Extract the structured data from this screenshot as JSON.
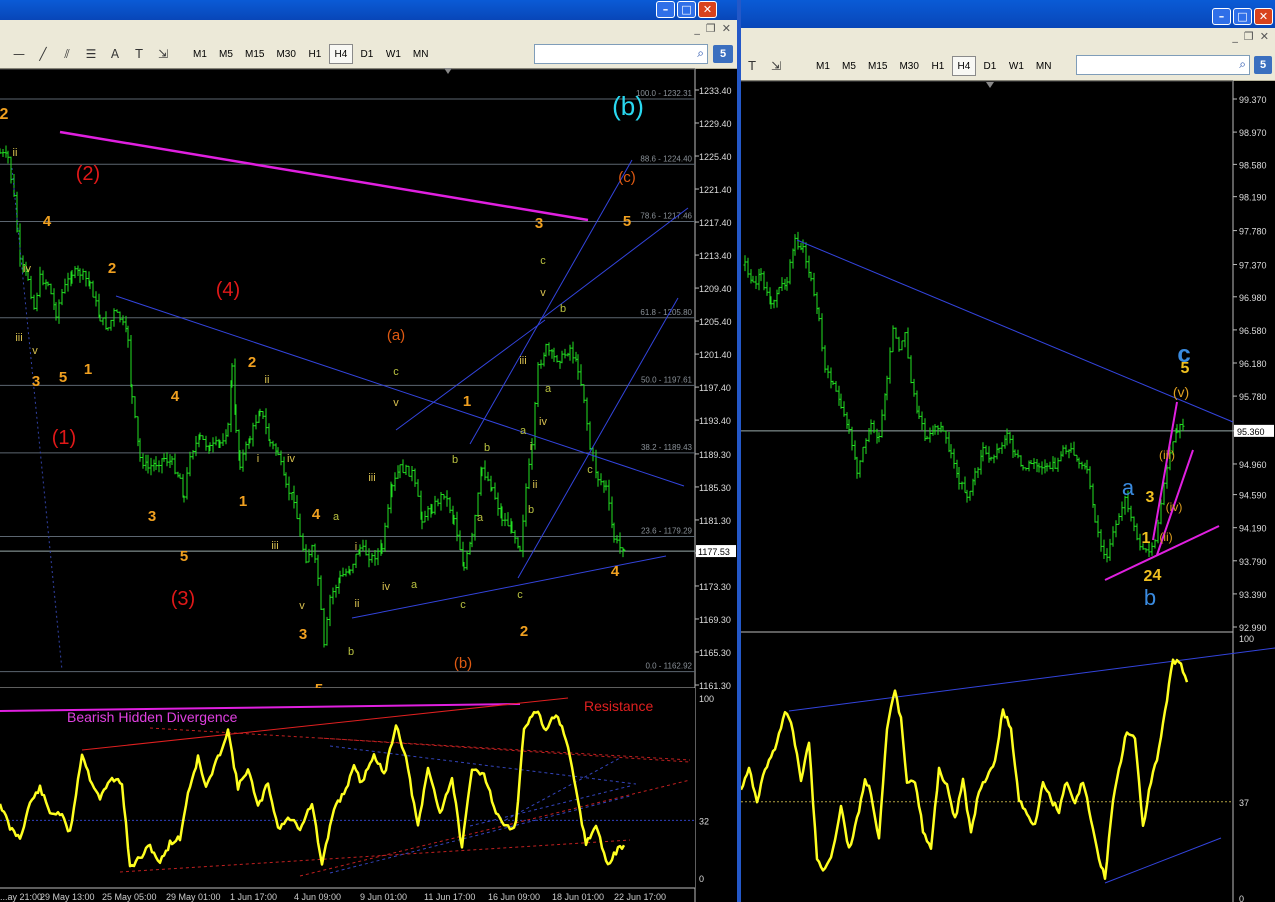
{
  "toolbar_left": {
    "timeframes": [
      "M1",
      "M5",
      "M15",
      "M30",
      "H1",
      "H4",
      "D1",
      "W1",
      "MN"
    ],
    "active_timeframe": "H4",
    "badge": "5",
    "tools": [
      "line",
      "diagonal",
      "channel",
      "fibo",
      "text",
      "label",
      "shapes"
    ]
  },
  "toolbar_right": {
    "timeframes": [
      "M1",
      "M5",
      "M15",
      "M30",
      "H1",
      "H4",
      "D1",
      "W1",
      "MN"
    ],
    "active_timeframe": "H4",
    "badge": "5"
  },
  "chart_data": [
    {
      "type": "line",
      "panel": "left-price",
      "y_ticks": [
        "1233.40",
        "1229.40",
        "1225.40",
        "1221.40",
        "1217.40",
        "1213.40",
        "1209.40",
        "1205.40",
        "1201.40",
        "1197.40",
        "1193.40",
        "1189.30",
        "1185.30",
        "1181.30",
        "1177.30",
        "1173.30",
        "1169.30",
        "1165.30",
        "1161.30"
      ],
      "ylim": [
        1161.3,
        1233.4
      ],
      "current_price": "1177.53",
      "fib_levels": [
        {
          "label": "100.0 - 1232.31",
          "value": 1232.31
        },
        {
          "label": "88.6 - 1224.40",
          "value": 1224.4
        },
        {
          "label": "78.6 - 1217.46",
          "value": 1217.46
        },
        {
          "label": "61.8 - 1205.80",
          "value": 1205.8
        },
        {
          "label": "50.0 - 1197.61",
          "value": 1197.61
        },
        {
          "label": "38.2 - 1189.43",
          "value": 1189.43
        },
        {
          "label": "23.6 - 1179.29",
          "value": 1179.29
        },
        {
          "label": "0.0 - 1162.92",
          "value": 1162.92
        }
      ],
      "x_ticks": [
        "...ay 21:00",
        "29 May 13:00",
        "25 May 05:00",
        "29 May 01:00",
        "1 Jun 17:00",
        "4 Jun 09:00",
        "9 Jun 01:00",
        "11 Jun 17:00",
        "16 Jun 09:00",
        "18 Jun 01:00",
        "22 Jun 17:00"
      ],
      "annotations": [
        {
          "text": "(b)",
          "color": "#29d8f0"
        },
        {
          "text": "(2)",
          "color": "#e01818"
        },
        {
          "text": "(4)",
          "color": "#e01818"
        },
        {
          "text": "(1)",
          "color": "#e01818"
        },
        {
          "text": "(3)",
          "color": "#e01818"
        },
        {
          "text": "(a)",
          "color": "#e05a12"
        },
        {
          "text": "(c)",
          "color": "#e05a12"
        },
        {
          "text": "(b)",
          "color": "#e05a12"
        },
        {
          "text": "2",
          "color": "#f0a020"
        },
        {
          "text": "4",
          "color": "#f0a020"
        },
        {
          "text": "2",
          "color": "#f0a020"
        },
        {
          "text": "3",
          "color": "#f0a020"
        },
        {
          "text": "5",
          "color": "#f0a020"
        },
        {
          "text": "1",
          "color": "#f0a020"
        },
        {
          "text": "4",
          "color": "#f0a020"
        },
        {
          "text": "2",
          "color": "#f0a020"
        },
        {
          "text": "3",
          "color": "#f0a020"
        },
        {
          "text": "1",
          "color": "#f0a020"
        },
        {
          "text": "5",
          "color": "#f0a020"
        },
        {
          "text": "4",
          "color": "#f0a020"
        },
        {
          "text": "3",
          "color": "#f0a020"
        },
        {
          "text": "5",
          "color": "#f0a020"
        },
        {
          "text": "1",
          "color": "#f0a020"
        },
        {
          "text": "2",
          "color": "#f0a020"
        },
        {
          "text": "3",
          "color": "#f0a020"
        },
        {
          "text": "5",
          "color": "#f0a020"
        },
        {
          "text": "4",
          "color": "#f0a020"
        }
      ]
    },
    {
      "type": "line",
      "panel": "left-oscillator",
      "y_ticks": [
        "100",
        "32",
        "0"
      ],
      "ylim": [
        0,
        100
      ],
      "labels": {
        "divergence": "Bearish Hidden Divergence",
        "resistance": "Resistance"
      }
    },
    {
      "type": "line",
      "panel": "right-price",
      "y_ticks": [
        "99.370",
        "98.970",
        "98.580",
        "98.190",
        "97.780",
        "97.370",
        "96.980",
        "96.580",
        "96.180",
        "95.780",
        "95.360",
        "94.960",
        "94.590",
        "94.190",
        "93.790",
        "93.390",
        "92.990"
      ],
      "ylim": [
        92.99,
        99.37
      ],
      "current_price": "95.360",
      "annotations": [
        {
          "text": "c",
          "color": "#3a8be0"
        },
        {
          "text": "5",
          "color": "#f0c020"
        },
        {
          "text": "(v)",
          "color": "#e0a020"
        },
        {
          "text": "(iii)",
          "color": "#e0a020"
        },
        {
          "text": "(iv)",
          "color": "#e0a020"
        },
        {
          "text": "(ii)",
          "color": "#e0a020"
        },
        {
          "text": "a",
          "color": "#3a8be0"
        },
        {
          "text": "b",
          "color": "#3a8be0"
        },
        {
          "text": "3",
          "color": "#f0c020"
        },
        {
          "text": "1",
          "color": "#f0c020"
        },
        {
          "text": "2",
          "color": "#f0c020"
        },
        {
          "text": "4",
          "color": "#f0c020"
        }
      ]
    },
    {
      "type": "line",
      "panel": "right-oscillator",
      "y_ticks": [
        "100",
        "37",
        "0"
      ],
      "ylim": [
        0,
        100
      ]
    }
  ]
}
